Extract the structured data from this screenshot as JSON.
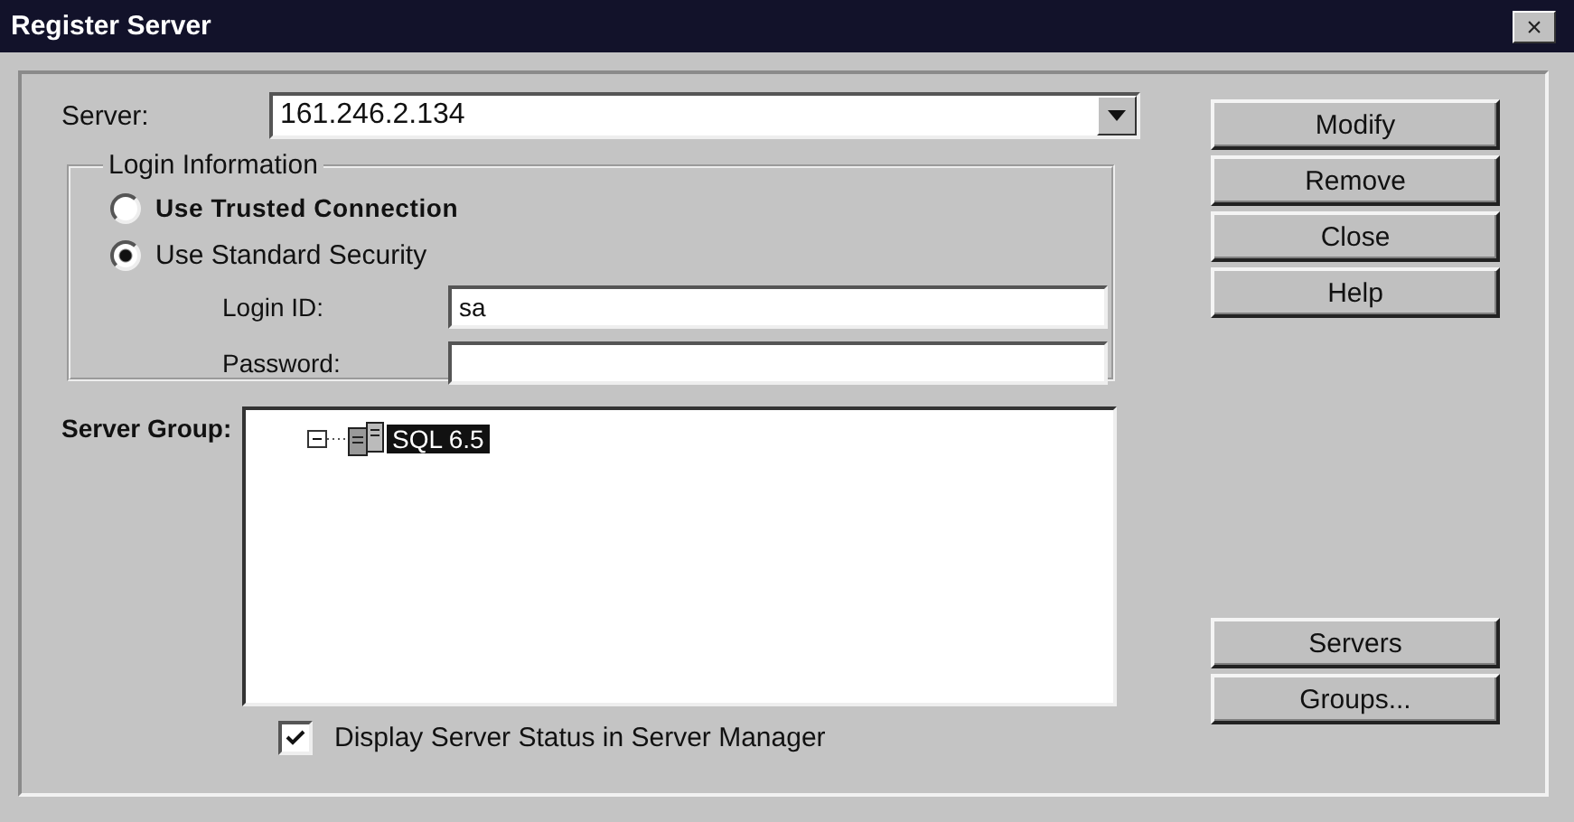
{
  "window": {
    "title": "Register Server",
    "close": "×"
  },
  "server": {
    "label": "Server:",
    "value": "161.246.2.134"
  },
  "login_information": {
    "title": "Login Information",
    "options": [
      {
        "label": "Use Trusted Connection",
        "selected": false
      },
      {
        "label": "Use Standard Security",
        "selected": true
      }
    ],
    "login_id": {
      "label": "Login ID:",
      "value": "sa"
    },
    "password": {
      "label": "Password:"
    }
  },
  "server_group": {
    "label": "Server Group:",
    "tree": [
      {
        "label": "SQL 6.5",
        "expanded": true,
        "selected": true
      }
    ]
  },
  "top_buttons": [
    "Modify",
    "Remove",
    "Close",
    "Help"
  ],
  "bottom_buttons": [
    "Servers",
    "Groups..."
  ],
  "display_status": {
    "label": "Display Server Status in Server Manager",
    "checked": true
  }
}
